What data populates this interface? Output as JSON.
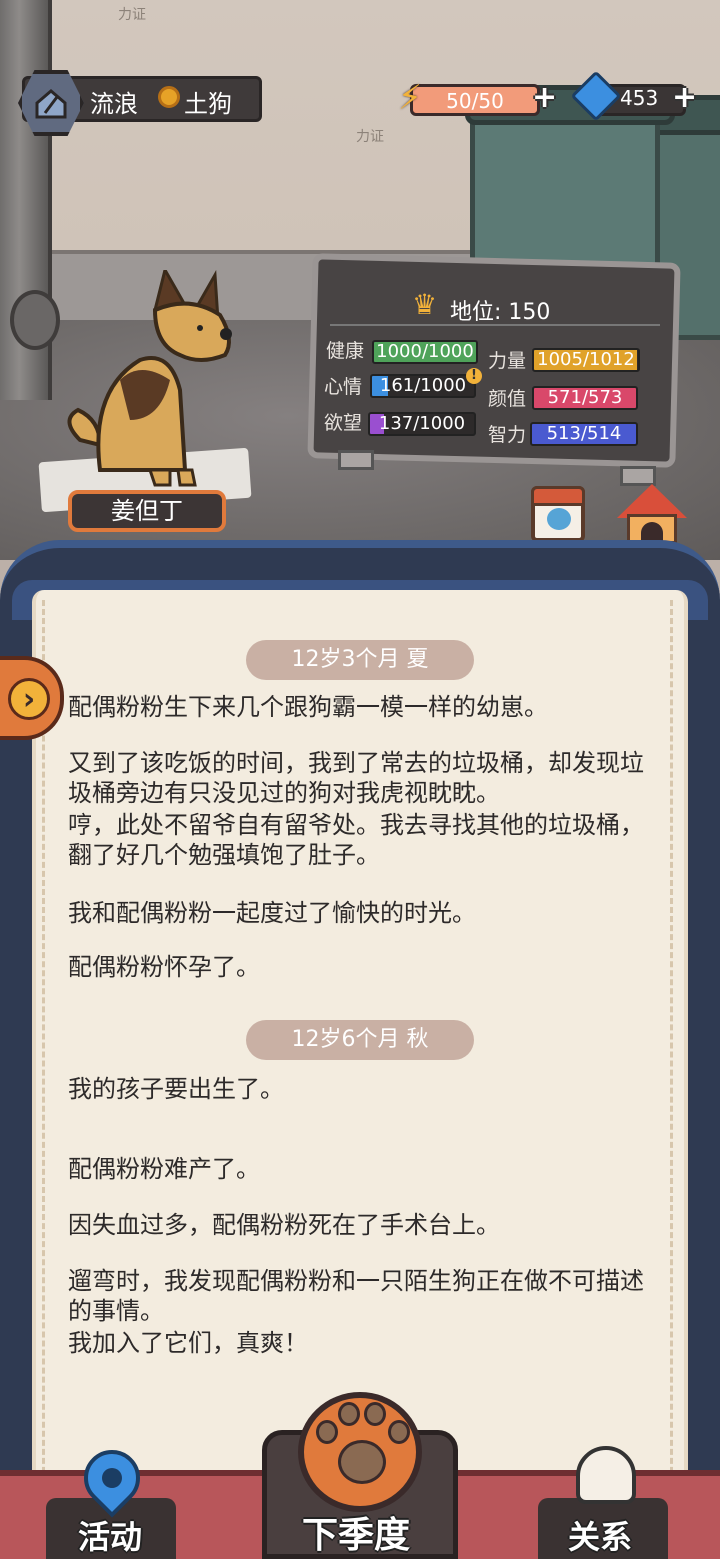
{
  "hud": {
    "status_label": "流浪",
    "rank_label": "土狗",
    "energy_text": "50/50",
    "energy_fraction": 1.0,
    "gems": "453",
    "emblem_icon": "broken-house-icon"
  },
  "scene": {
    "scribble_1": "力证",
    "scribble_2": "力证"
  },
  "dog": {
    "name": "姜但丁"
  },
  "stats": {
    "status_label": "地位: 150",
    "items": [
      {
        "label": "健康",
        "value": "1000/1000",
        "fraction": 1.0,
        "color": "#4fa35a"
      },
      {
        "label": "力量",
        "value": "1005/1012",
        "fraction": 0.993,
        "color": "#e0a22a"
      },
      {
        "label": "心情",
        "value": "161/1000",
        "fraction": 0.161,
        "color": "#3c8fe0"
      },
      {
        "label": "颜值",
        "value": "571/573",
        "fraction": 0.996,
        "color": "#d9486a"
      },
      {
        "label": "欲望",
        "value": "137/1000",
        "fraction": 0.137,
        "color": "#9a4fd0"
      },
      {
        "label": "智力",
        "value": "513/514",
        "fraction": 0.998,
        "color": "#4a5ad0"
      }
    ],
    "warning_glyph": "!"
  },
  "side_buttons": {
    "tasks": "任务",
    "kennel": "狗窝"
  },
  "journal": {
    "season_1": "12岁3个月 夏",
    "entries_1": [
      "配偶粉粉生下来几个跟狗霸一模一样的幼崽。",
      "又到了该吃饭的时间，我到了常去的垃圾桶，却发现垃圾桶旁边有只没见过的狗对我虎视眈眈。",
      "哼，此处不留爷自有留爷处。我去寻找其他的垃圾桶，翻了好几个勉强填饱了肚子。",
      "我和配偶粉粉一起度过了愉快的时光。",
      "配偶粉粉怀孕了。"
    ],
    "season_2": "12岁6个月 秋",
    "entries_2": [
      "我的孩子要出生了。",
      "配偶粉粉难产了。",
      "因失血过多，配偶粉粉死在了手术台上。",
      "遛弯时，我发现配偶粉粉和一只陌生狗正在做不可描述的事情。",
      "我加入了它们，真爽！"
    ]
  },
  "nav": {
    "activity": "活动",
    "next_season": "下季度",
    "relations": "关系"
  }
}
